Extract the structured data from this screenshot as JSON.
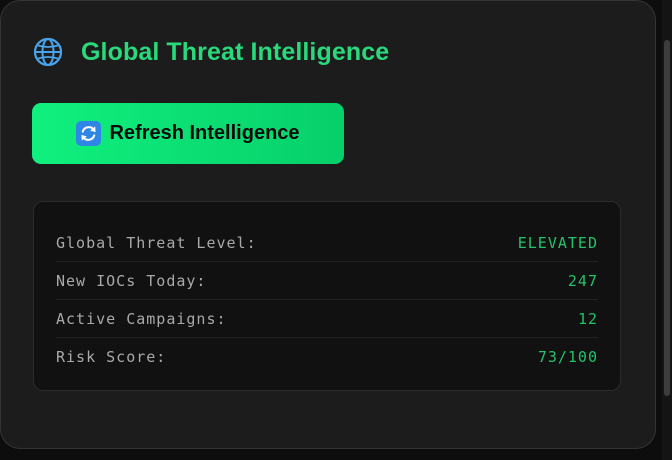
{
  "panel": {
    "title": "Global Threat Intelligence",
    "title_icon": "globe-icon",
    "accent_color": "#29d97b"
  },
  "refresh_button": {
    "label": "Refresh Intelligence",
    "icon": "refresh-icon"
  },
  "stats": [
    {
      "label": "Global Threat Level:",
      "value": "ELEVATED"
    },
    {
      "label": "New IOCs Today:",
      "value": "247"
    },
    {
      "label": "Active Campaigns:",
      "value": "12"
    },
    {
      "label": "Risk Score:",
      "value": "73/100"
    }
  ]
}
